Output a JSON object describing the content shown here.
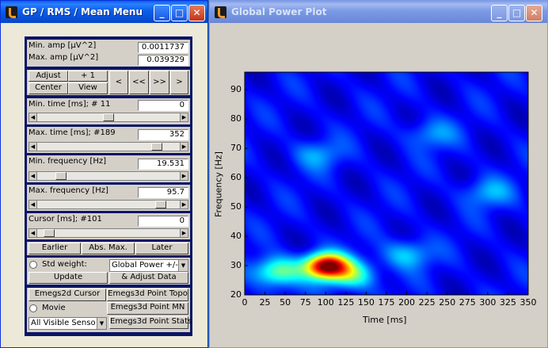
{
  "left_window": {
    "title": "GP / RMS / Mean Menu",
    "min_amp_label": "Min. amp [µV^2]",
    "min_amp_value": "0.0011737",
    "max_amp_label": "Max. amp [µV^2]",
    "max_amp_value": "0.039329",
    "adjust_label": "Adjust",
    "plus1_label": "+ 1",
    "center_label": "Center",
    "view_label": "View",
    "nav_prev_label": "<",
    "nav_prev2_label": "<<",
    "nav_next2_label": ">>",
    "nav_next_label": ">",
    "min_time_label": "Min. time [ms]; # 11",
    "min_time_value": "0",
    "max_time_label": "Max. time [ms]; #189",
    "max_time_value": "352",
    "min_freq_label": "Min. frequency [Hz]",
    "min_freq_value": "19.531",
    "max_freq_label": "Max. frequency [Hz]",
    "max_freq_value": "95.7",
    "cursor_label": "Cursor [ms]; #101",
    "cursor_value": "0",
    "earlier_label": "Earlier",
    "absmax_label": "Abs. Max.",
    "later_label": "Later",
    "stdweight_label": "Std weight:",
    "measure_selected": "Global Power +/-",
    "update_label": "Update",
    "adjust_data_label": "& Adjust Data",
    "emegs2d_cursor_label": "Emegs2d Cursor",
    "emegs3d_point_topo_label": "Emegs3d Point Topo",
    "movie_label": "Movie",
    "emegs3d_point_mn_label": "Emegs3d Point MN",
    "sensors_selected": "All Visible Senso",
    "emegs3d_point_stats_label": "Emegs3d Point Stats"
  },
  "sliders": {
    "min_time": 0.5,
    "max_time": 0.87,
    "min_freq": 0.14,
    "max_freq": 0.9,
    "cursor": 0.05
  },
  "right_window": {
    "title": "Global Power Plot"
  },
  "chart_data": {
    "type": "heatmap",
    "xlabel": "Time [ms]",
    "ylabel": "Frequency [Hz]",
    "xlim": [
      0,
      350
    ],
    "ylim": [
      20,
      96
    ],
    "xticks": [
      0,
      25,
      50,
      75,
      100,
      125,
      150,
      175,
      200,
      225,
      250,
      275,
      300,
      325,
      350
    ],
    "yticks": [
      20,
      30,
      40,
      50,
      60,
      70,
      80,
      90
    ],
    "colormap": "jet",
    "hotspots": [
      {
        "time": 100,
        "freq": 30,
        "intensity": 1.0
      },
      {
        "time": 40,
        "freq": 28,
        "intensity": 0.45
      },
      {
        "time": 130,
        "freq": 27,
        "intensity": 0.4
      },
      {
        "time": 200,
        "freq": 34,
        "intensity": 0.25
      },
      {
        "time": 300,
        "freq": 55,
        "intensity": 0.2
      },
      {
        "time": 230,
        "freq": 75,
        "intensity": 0.18
      },
      {
        "time": 90,
        "freq": 68,
        "intensity": 0.18
      }
    ]
  },
  "colors": {
    "titlebar_active": "#0a5fe8",
    "panel_bg": "#0a1466",
    "plot_bg": "#d4d0c8"
  }
}
